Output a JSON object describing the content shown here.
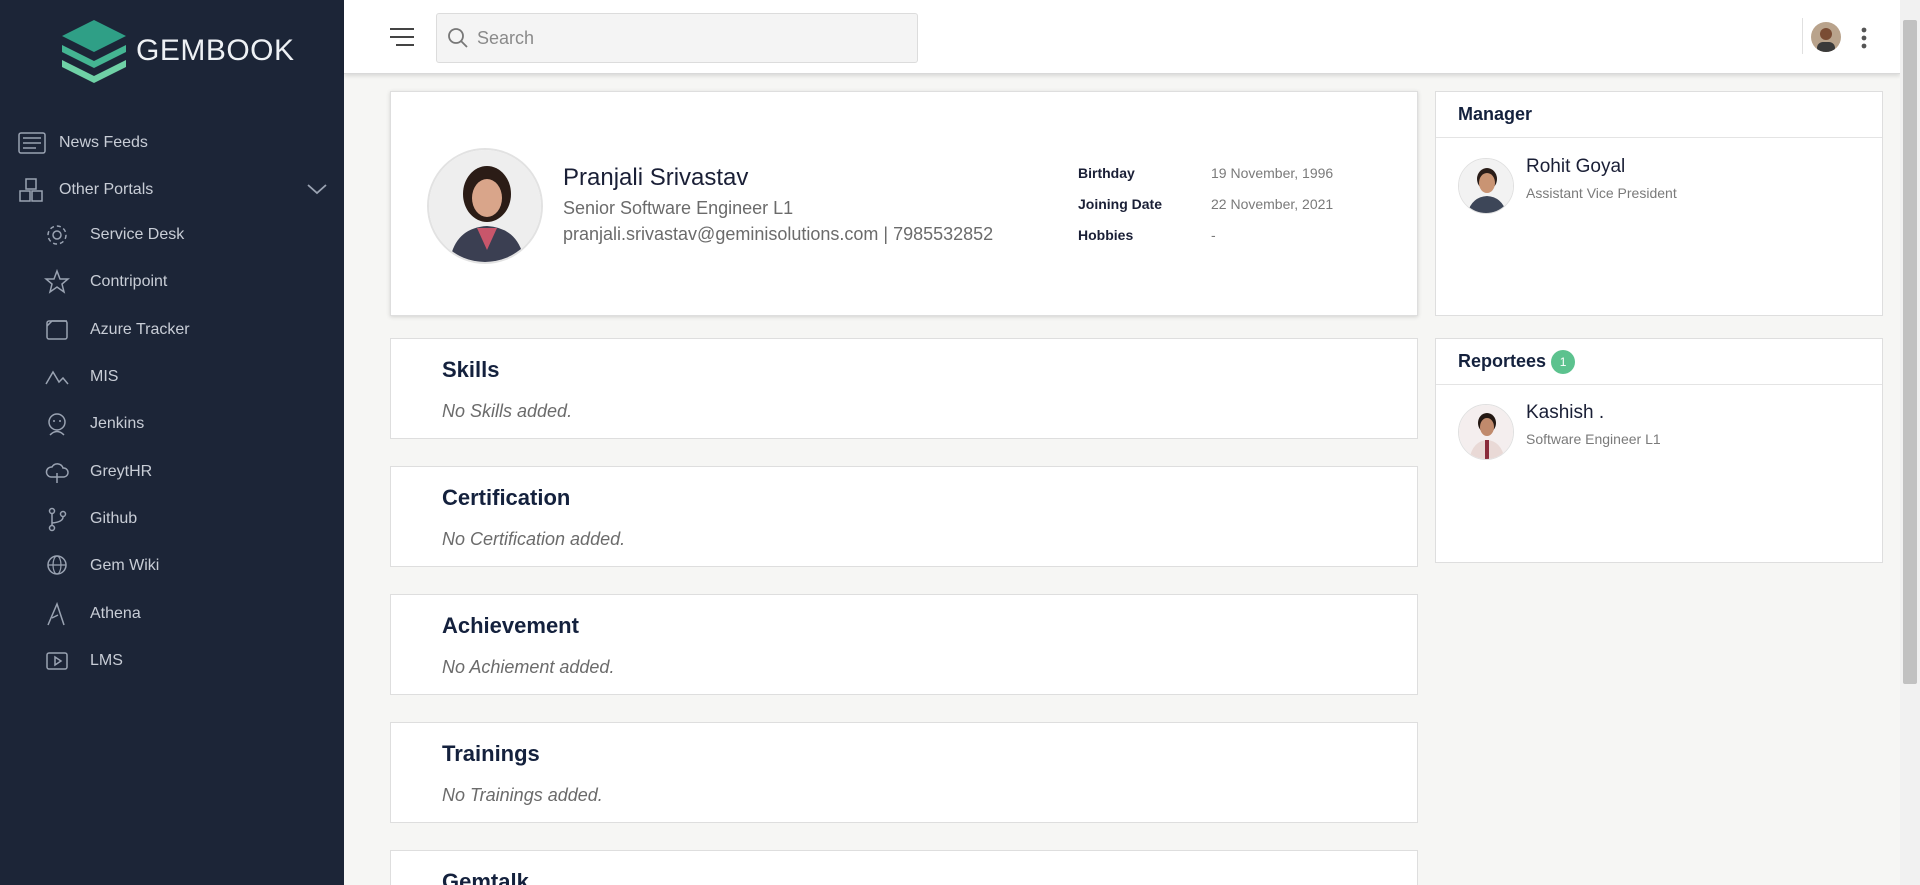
{
  "sidebar": {
    "brand": "GEMBOOK",
    "items": [
      {
        "label": "News Feeds",
        "icon": "news-feed-icon"
      },
      {
        "label": "Other Portals",
        "icon": "portals-icon"
      }
    ],
    "portals": [
      {
        "label": "Service Desk",
        "icon": "gear-icon"
      },
      {
        "label": "Contripoint",
        "icon": "star-icon"
      },
      {
        "label": "Azure Tracker",
        "icon": "tracker-icon"
      },
      {
        "label": "MIS",
        "icon": "chart-line-icon"
      },
      {
        "label": "Jenkins",
        "icon": "jenkins-icon"
      },
      {
        "label": "GreytHR",
        "icon": "cloud-icon"
      },
      {
        "label": "Github",
        "icon": "branch-icon"
      },
      {
        "label": "Gem Wiki",
        "icon": "globe-icon"
      },
      {
        "label": "Athena",
        "icon": "triangle-icon"
      },
      {
        "label": "LMS",
        "icon": "video-icon"
      }
    ]
  },
  "header": {
    "search_placeholder": "Search"
  },
  "profile": {
    "name": "Pranjali Srivastav",
    "title": "Senior Software Engineer L1",
    "contact": "pranjali.srivastav@geminisolutions.com | 7985532852",
    "info": [
      {
        "label": "Birthday",
        "value": "19 November, 1996"
      },
      {
        "label": "Joining Date",
        "value": "22 November, 2021"
      },
      {
        "label": "Hobbies",
        "value": "-"
      }
    ]
  },
  "sections": [
    {
      "title": "Skills",
      "empty": "No Skills added."
    },
    {
      "title": "Certification",
      "empty": "No Certification added."
    },
    {
      "title": "Achievement",
      "empty": "No Achiement added."
    },
    {
      "title": "Trainings",
      "empty": "No Trainings added."
    },
    {
      "title": "Gemtalk",
      "empty": ""
    }
  ],
  "manager": {
    "heading": "Manager",
    "name": "Rohit Goyal",
    "role": "Assistant Vice President"
  },
  "reportees": {
    "heading": "Reportees",
    "count": "1",
    "name": "Kashish .",
    "role": "Software Engineer L1"
  },
  "colors": {
    "sidebar_bg": "#1c2537",
    "badge": "#5cc28e",
    "heading": "#14213d"
  }
}
